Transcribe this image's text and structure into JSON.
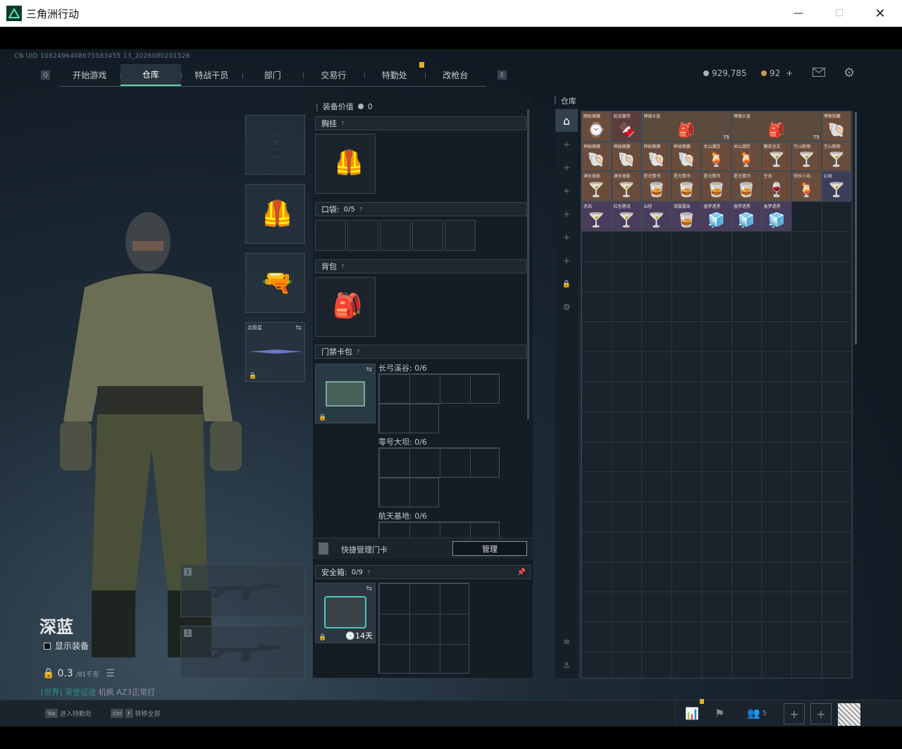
{
  "window": {
    "title": "三角洲行动"
  },
  "header": {
    "uid": "CN UID 1082496408675583455 13_2026080201526",
    "tabs": [
      "开始游戏",
      "仓库",
      "特战干员",
      "部门",
      "交易行",
      "特勤处",
      "改枪台"
    ],
    "active_tab": "仓库",
    "key_left": "Q",
    "key_right": "E",
    "silver": "929,785",
    "gold": "92",
    "gold_plus": "+"
  },
  "character": {
    "name": "深蓝",
    "show_equip_label": "显示装备",
    "weight_value": "0.3",
    "weight_unit": "/81千克",
    "status_highlight": "[世界] 荣誉征途",
    "status_text": " 机枫 AZ3正常打",
    "melee_label": "北极星",
    "weapon_slot_1": "1",
    "weapon_slot_2": "2"
  },
  "equipment": {
    "value_label": "装备价值",
    "value": "0",
    "chest_rig": "胸挂",
    "pockets": "口袋:",
    "pockets_count": "0/5",
    "backpack": "背包",
    "keycard_bag": "门禁卡包",
    "groups": [
      {
        "label": "长弓溪谷: 0/6"
      },
      {
        "label": "零号大坝: 0/6"
      },
      {
        "label": "航天基地: 0/6"
      }
    ],
    "quick_manage": "快捷管理门卡",
    "manage_button": "管理",
    "safebox": "安全箱:",
    "safebox_count": "0/9",
    "safebox_days": "14天"
  },
  "warehouse": {
    "title": "仓库",
    "items": [
      {
        "name": "随机面膜",
        "icon": "⌚",
        "bg": "#6a4c3c"
      },
      {
        "name": "蛇皮腰带",
        "icon": "🍫",
        "bg": "#5c3c3c"
      },
      {
        "name": "博德头盔",
        "icon": "🎒",
        "bg": "#5c4a3c",
        "badge": "75"
      },
      {
        "name": "博德头盔",
        "icon": "🎒",
        "bg": "#5c4a3c",
        "badge": "75"
      },
      {
        "name": "博物馆藏",
        "icon": "🐚",
        "bg": "#6a4c3c"
      },
      {
        "name": "神秘面膜",
        "icon": "🐚",
        "bg": "#6a4c3c"
      },
      {
        "name": "神秘面膜",
        "icon": "🐚",
        "bg": "#6a4c3c"
      },
      {
        "name": "神秘面膜",
        "icon": "🐚",
        "bg": "#6a4c3c"
      },
      {
        "name": "神秘面膜",
        "icon": "🐚",
        "bg": "#6a4c3c"
      },
      {
        "name": "关山潮饮",
        "icon": "🍹",
        "bg": "#6a4c3c"
      },
      {
        "name": "关山潮饮",
        "icon": "🍹",
        "bg": "#6a4c3c"
      },
      {
        "name": "糖浆龙舌",
        "icon": "🍸",
        "bg": "#6a4c3c"
      },
      {
        "name": "空山新雨",
        "icon": "🍸",
        "bg": "#6a4c3c"
      },
      {
        "name": "空山新雨",
        "icon": "🍸",
        "bg": "#6a4c3c"
      },
      {
        "name": "漠长夜影",
        "icon": "🍸",
        "bg": "#6a4c3c"
      },
      {
        "name": "漠长夜影",
        "icon": "🍸",
        "bg": "#6a4c3c"
      },
      {
        "name": "星光情书",
        "icon": "🥃",
        "bg": "#6a4c3c"
      },
      {
        "name": "星光情书",
        "icon": "🥃",
        "bg": "#6a4c3c"
      },
      {
        "name": "星光情书",
        "icon": "🥃",
        "bg": "#6a4c3c"
      },
      {
        "name": "星光情书",
        "icon": "🥃",
        "bg": "#6a4c3c"
      },
      {
        "name": "空岛",
        "icon": "🍷",
        "bg": "#6a4c3c"
      },
      {
        "name": "快乐小岛",
        "icon": "🍹",
        "bg": "#6a4c3c"
      },
      {
        "name": "幻境",
        "icon": "🍸",
        "bg": "#3c3c5c"
      },
      {
        "name": "赤焰",
        "icon": "🍸",
        "bg": "#4a3c5c"
      },
      {
        "name": "红色警戒",
        "icon": "🍸",
        "bg": "#4a3c5c"
      },
      {
        "name": "启程",
        "icon": "🍸",
        "bg": "#4a3c5c"
      },
      {
        "name": "清晨露珠",
        "icon": "🥃",
        "bg": "#4a3c5c"
      },
      {
        "name": "香梦透黑",
        "icon": "🧊",
        "bg": "#4a3c5c"
      },
      {
        "name": "香梦透黑",
        "icon": "🧊",
        "bg": "#4a3c5c"
      },
      {
        "name": "香梦透黑",
        "icon": "🧊",
        "bg": "#4a3c5c"
      }
    ]
  },
  "footer": {
    "key_tab": "Tab",
    "tab_action": "进入特勤处",
    "key_ctrl": "Ctrl",
    "key_f": "F",
    "ctrl_action": "转移全部",
    "friends": "5"
  }
}
